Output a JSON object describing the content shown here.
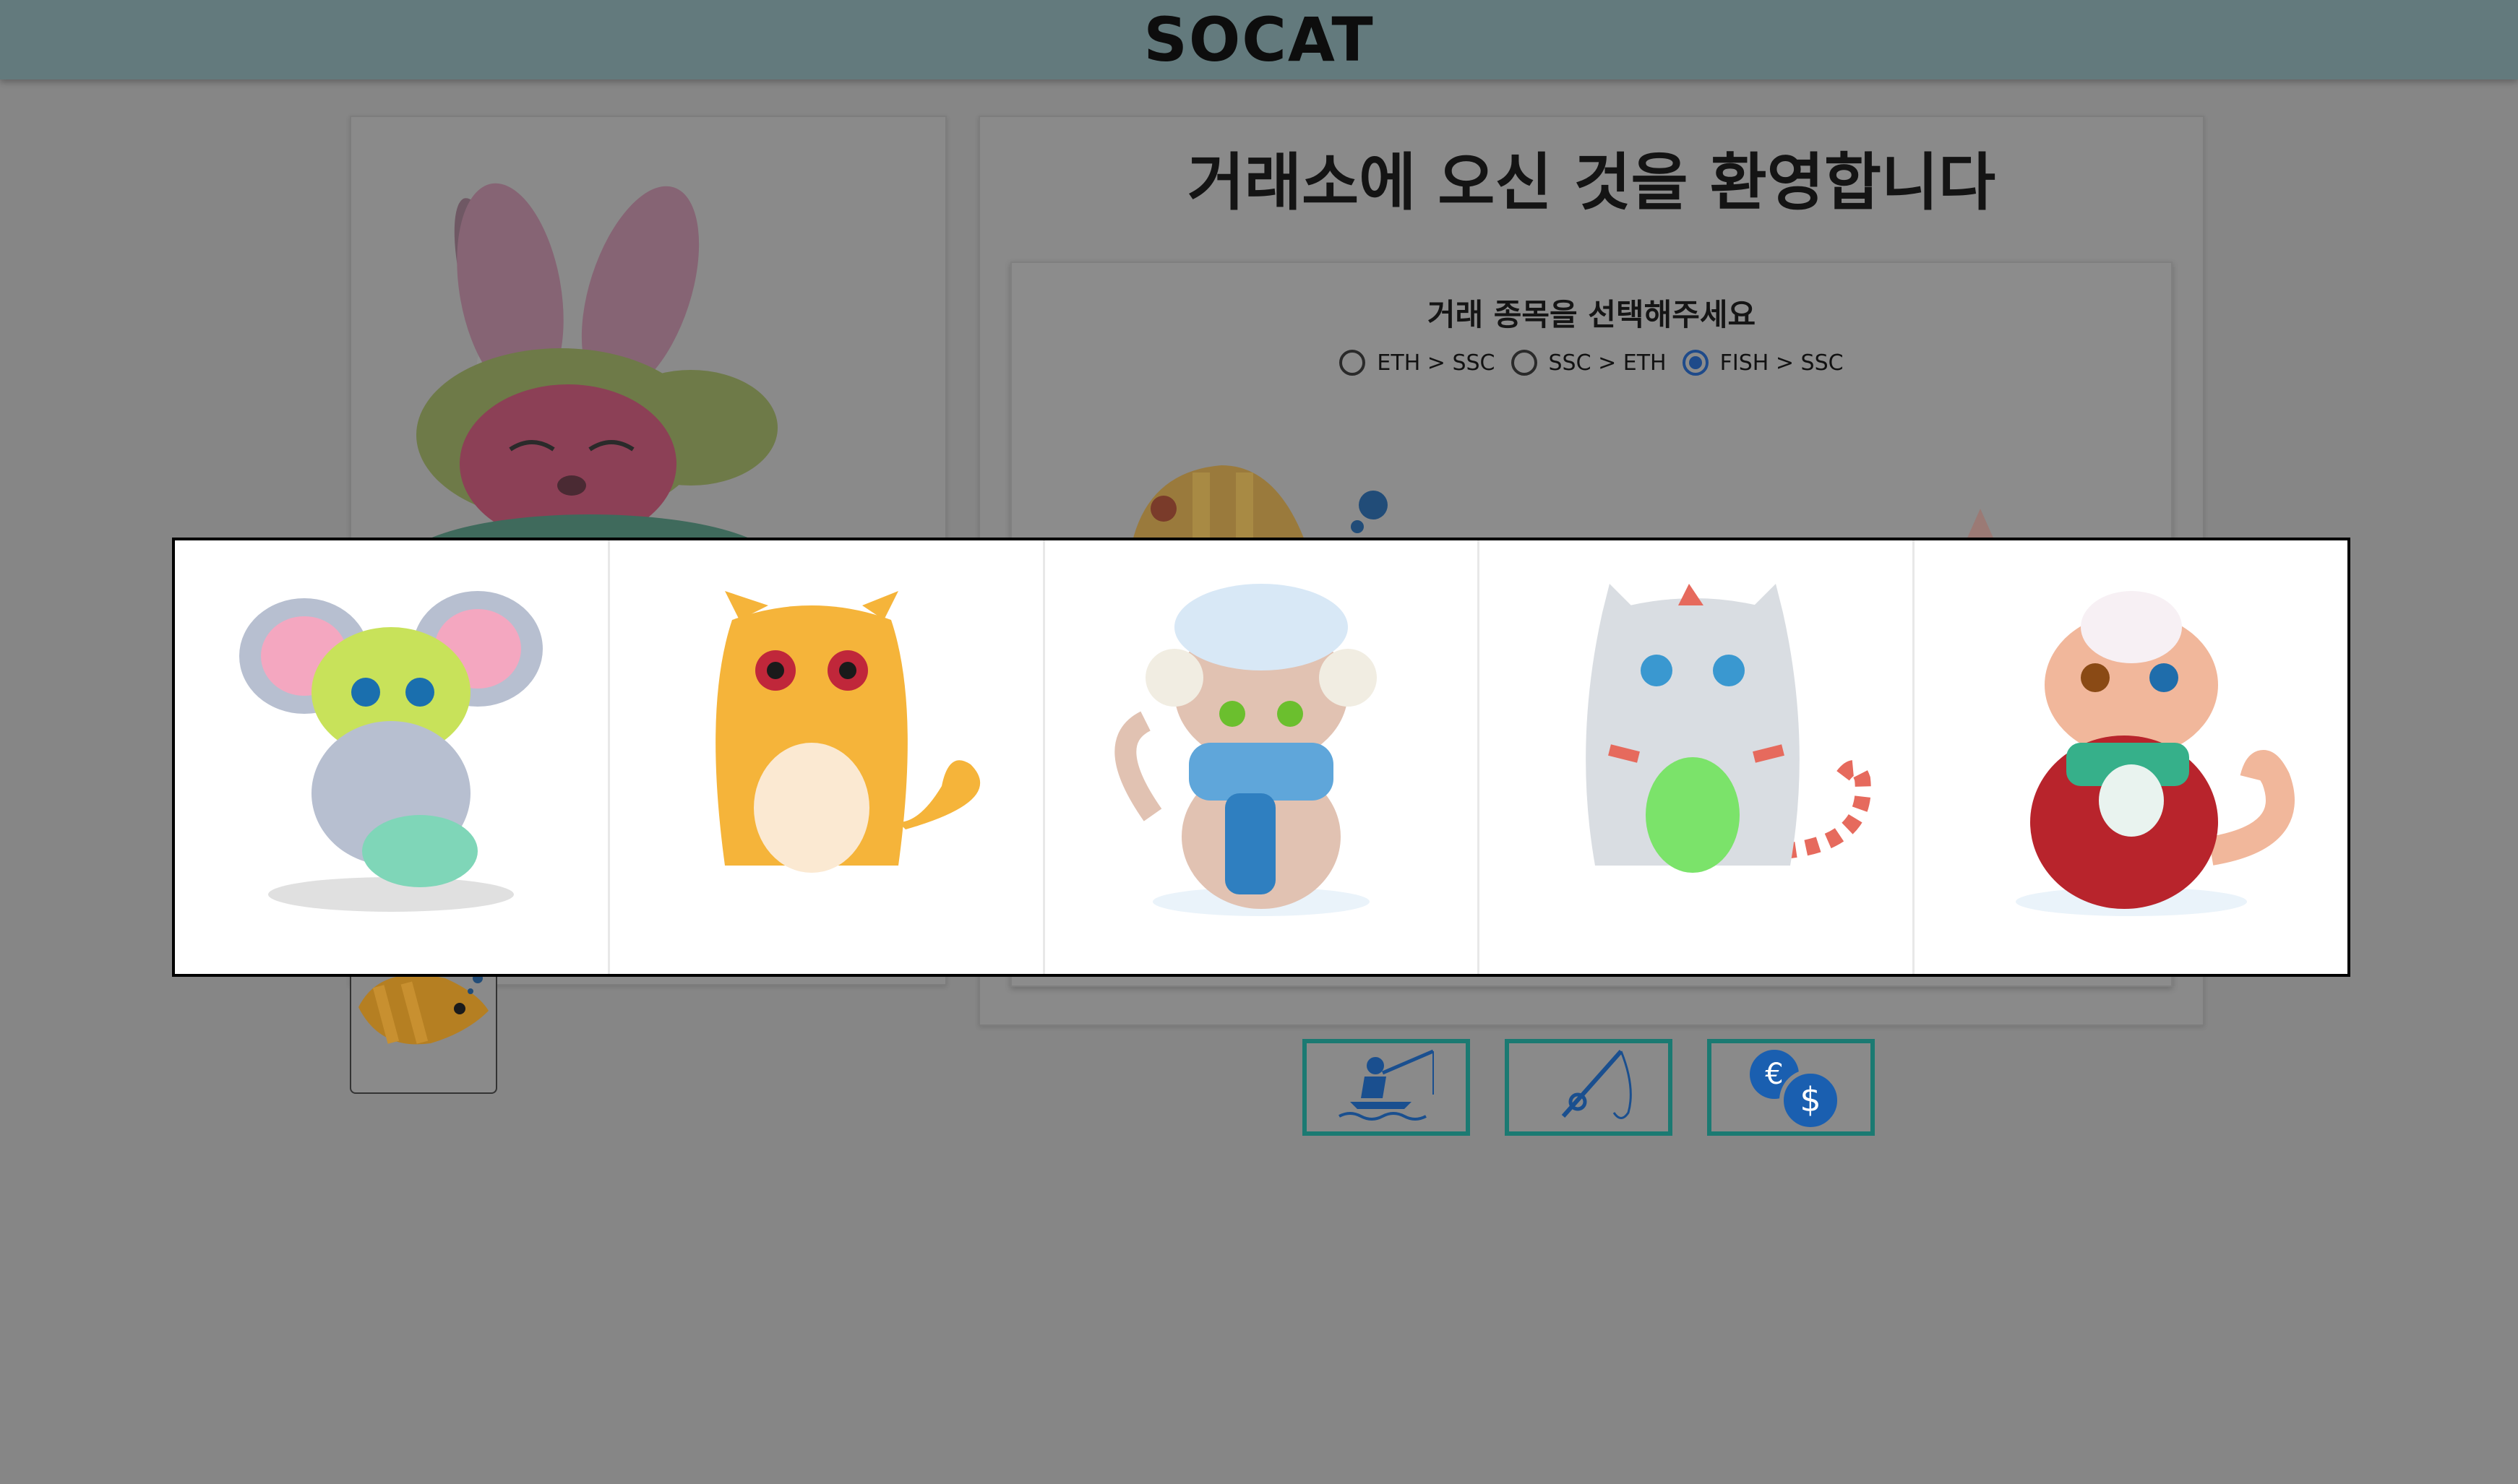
{
  "header": {
    "title": "SOCAT"
  },
  "exchange": {
    "welcome": "거래소에 오신 것을 환영합니다",
    "select_title": "거래 종목을 선택해주세요",
    "options": [
      {
        "label": "ETH > SSC",
        "checked": false
      },
      {
        "label": "SSC > ETH",
        "checked": false
      },
      {
        "label": "FISH > SSC",
        "checked": true
      }
    ]
  },
  "gallery": {
    "items": [
      {
        "name": "elephant-costume-cat",
        "color": "#b7bfd0"
      },
      {
        "name": "orange-tabby-cat",
        "color": "#f5b43a"
      },
      {
        "name": "winter-scarf-cat",
        "color": "#e1c2b2"
      },
      {
        "name": "gray-striped-cat",
        "color": "#d9dde2"
      },
      {
        "name": "peach-sweater-cat",
        "color": "#f1b79b"
      }
    ]
  },
  "actions": [
    {
      "icon": "fishing-person-icon"
    },
    {
      "icon": "fishing-rod-icon"
    },
    {
      "icon": "currency-exchange-icon"
    }
  ],
  "colors": {
    "header_bg": "#637a7d",
    "accent": "#1b7a72",
    "radio": "#1e4a8a",
    "icon": "#1a5fb0"
  }
}
